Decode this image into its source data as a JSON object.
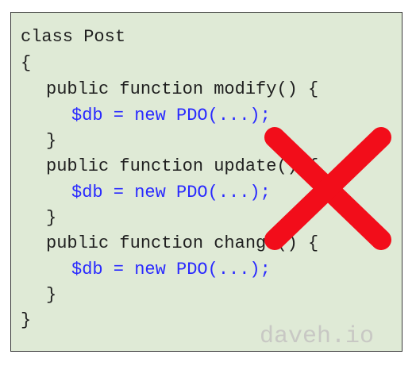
{
  "code": {
    "lines": [
      "class Post",
      "{",
      "public function modify() {",
      "$db = new PDO(...);",
      "}",
      "public function update() {",
      "$db = new PDO(...);",
      "}",
      "public function change() {",
      "$db = new PDO(...);",
      "}",
      "}"
    ]
  },
  "overlay": {
    "cross_icon": "x-icon",
    "cross_color": "#f20d1a"
  },
  "watermark": {
    "text": "daveh.io"
  },
  "colors": {
    "background": "#dfead6",
    "keyword_blue": "#2929ff",
    "text": "#1f1f1f",
    "watermark": "#c8c8c4"
  }
}
